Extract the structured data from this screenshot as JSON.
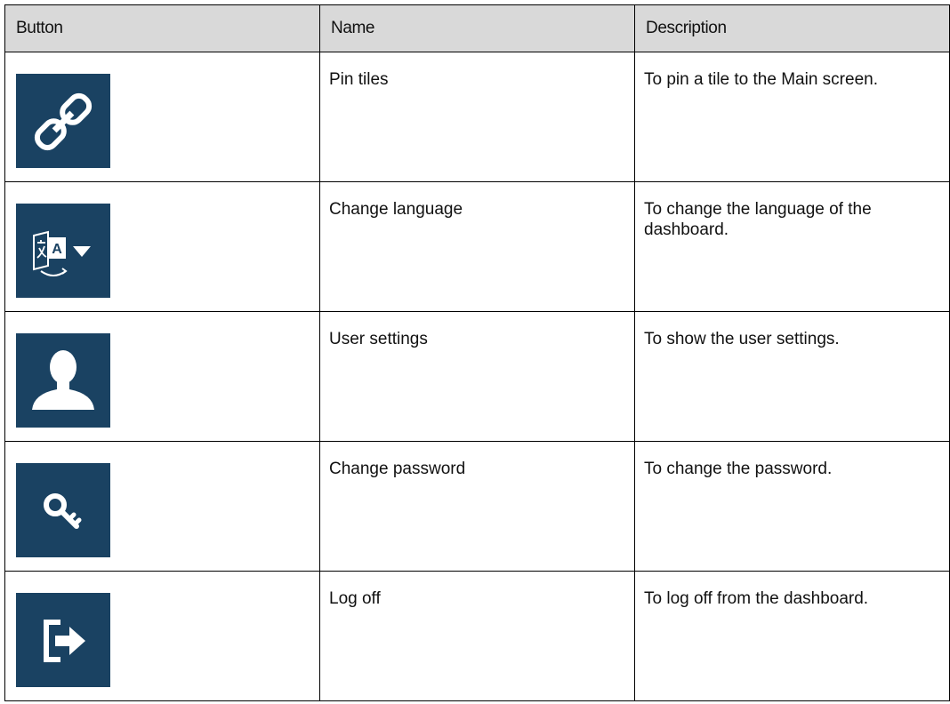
{
  "table": {
    "headers": {
      "button": "Button",
      "name": "Name",
      "description": "Description"
    },
    "rows": [
      {
        "icon": "link-icon",
        "name": "Pin tiles",
        "description": "To pin a tile to the Main screen."
      },
      {
        "icon": "translate-dropdown-icon",
        "name": "Change language",
        "description": "To change the language of the dashboard."
      },
      {
        "icon": "user-icon",
        "name": "User settings",
        "description": "To show the user settings."
      },
      {
        "icon": "key-icon",
        "name": "Change password",
        "description": "To change the password."
      },
      {
        "icon": "log-off-icon",
        "name": "Log off",
        "description": "To log off from the dashboard."
      }
    ]
  },
  "colors": {
    "icon_tile": "#1a4262",
    "icon_glyph": "#ffffff",
    "header_bg": "#d9d9d9"
  }
}
